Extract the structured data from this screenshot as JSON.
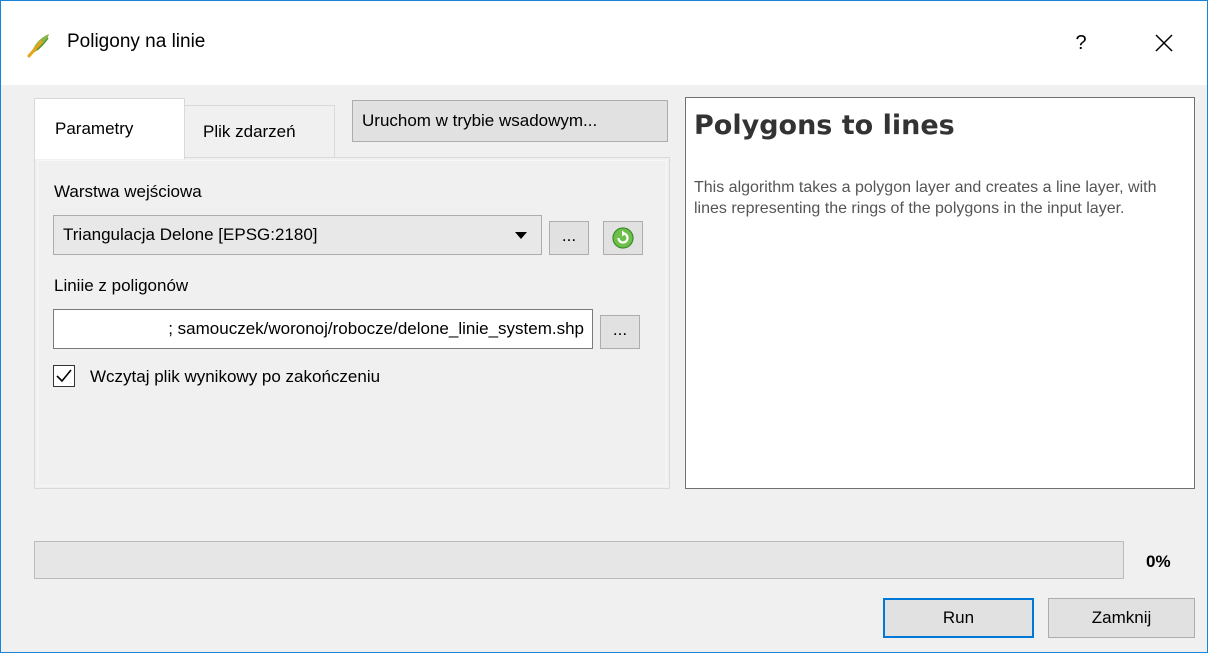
{
  "window": {
    "title": "Poligony na linie",
    "help_symbol": "?"
  },
  "tabs": [
    {
      "label": "Parametry",
      "active": true
    },
    {
      "label": "Plik zdarzeń",
      "active": false
    }
  ],
  "batch_button_label": "Uruchom w trybie wsadowym...",
  "form": {
    "input_layer_label": "Warstwa wejściowa",
    "input_layer_value": "Triangulacja Delone [EPSG:2180]",
    "browse_label": "...",
    "output_label": "Liniie z poligonów",
    "output_value": "; samouczek/woronoj/robocze/delone_linie_system.shp",
    "load_result_label": "Wczytaj plik wynikowy po zakończeniu",
    "load_result_checked": true
  },
  "help": {
    "title": "Polygons to lines",
    "description": "This algorithm takes a polygon layer and creates a line layer, with lines representing the rings of the polygons in the input layer."
  },
  "progress": {
    "value": 0,
    "label": "0%"
  },
  "buttons": {
    "run": "Run",
    "close": "Zamknij"
  },
  "colors": {
    "accent": "#0078d7",
    "window_border": "#1883d7",
    "qgis_green": "#589632",
    "progress_fill": "#06b025"
  },
  "icons": {
    "app": "qgis-icon",
    "close": "close-icon",
    "refresh": "refresh-icon",
    "dropdown": "chevron-down-icon",
    "check": "checkmark-icon"
  }
}
